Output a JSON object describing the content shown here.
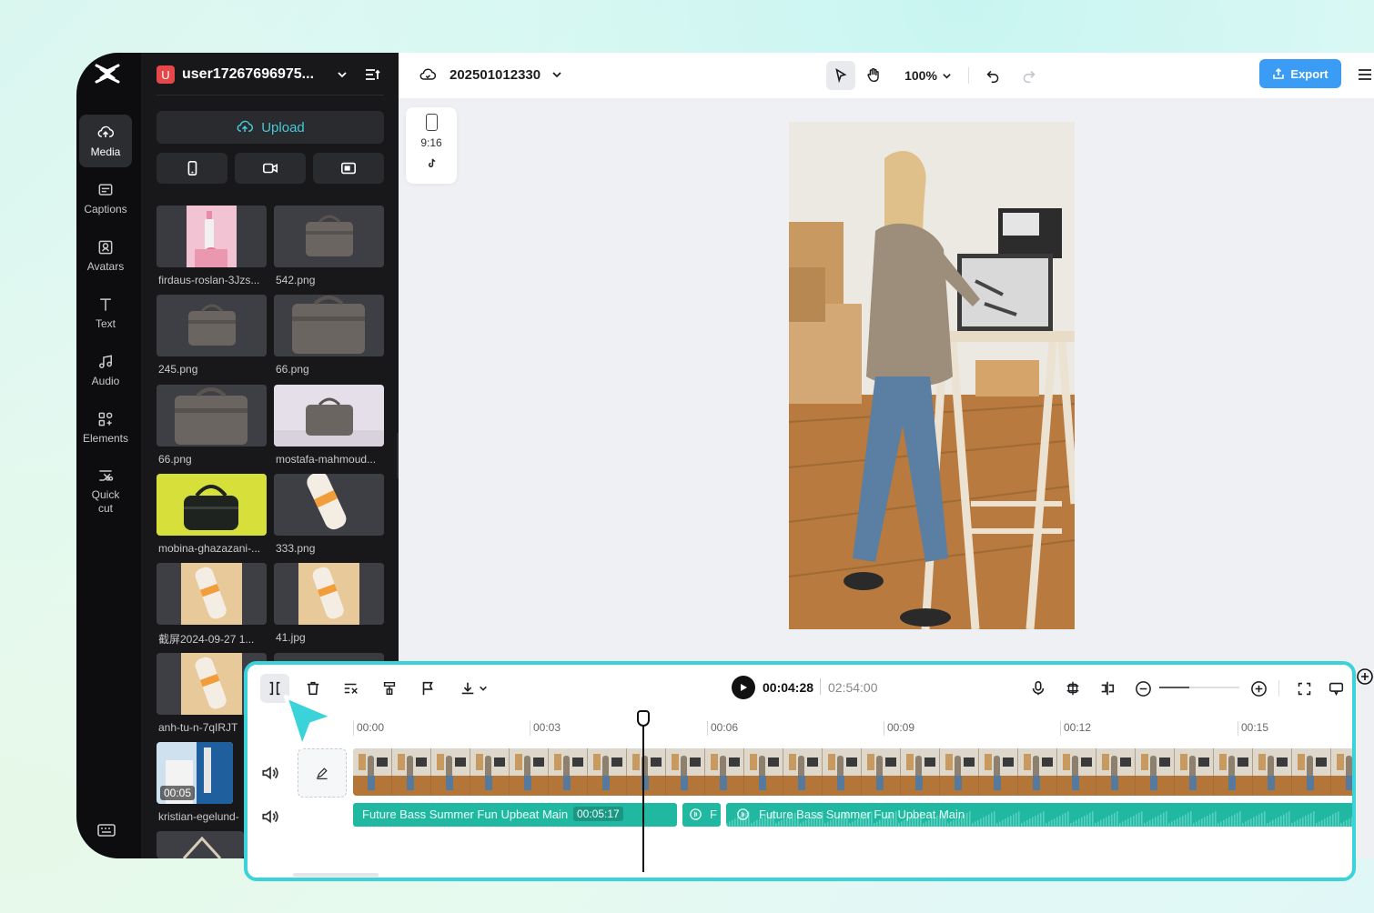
{
  "rail": {
    "items": [
      {
        "label": "Media",
        "icon": "cloud-upload-icon"
      },
      {
        "label": "Captions",
        "icon": "captions-icon"
      },
      {
        "label": "Avatars",
        "icon": "avatar-icon"
      },
      {
        "label": "Text",
        "icon": "text-icon"
      },
      {
        "label": "Audio",
        "icon": "music-note-icon"
      },
      {
        "label": "Elements",
        "icon": "elements-icon"
      },
      {
        "label": "Quick cut",
        "icon": "quick-cut-icon"
      }
    ]
  },
  "media": {
    "user_initial": "U",
    "user_name": "user17267696975...",
    "upload_label": "Upload",
    "items": [
      {
        "label": "firdaus-roslan-3Jzs..."
      },
      {
        "label": "542.png"
      },
      {
        "label": "245.png"
      },
      {
        "label": "66.png"
      },
      {
        "label": "66.png"
      },
      {
        "label": "mostafa-mahmoud..."
      },
      {
        "label": "mobina-ghazazani-..."
      },
      {
        "label": "333.png"
      },
      {
        "label": "截屏2024-09-27 1..."
      },
      {
        "label": "41.jpg"
      },
      {
        "label": "anh-tu-n-7qIRJT"
      },
      {
        "label": ""
      },
      {
        "label": "kristian-egelund-",
        "duration": "00:05"
      },
      {
        "label": ""
      }
    ]
  },
  "topbar": {
    "project_name": "202501012330",
    "zoom": "100%",
    "export_label": "Export"
  },
  "canvas": {
    "ratio_label": "9:16",
    "ratio_platform_icon": "tiktok-icon"
  },
  "timeline": {
    "current_time": "00:04:28",
    "total_time": "02:54:00",
    "ruler": [
      "00:00",
      "00:03",
      "00:06",
      "00:09",
      "00:12",
      "00:15"
    ],
    "audio_clip_1": {
      "title": "Future Bass Summer Fun Upbeat Main",
      "duration": "00:05:17"
    },
    "audio_clip_2": {
      "title": "F"
    },
    "audio_clip_3": {
      "title": "Future Bass Summer Fun Upbeat Main"
    },
    "zoom_level": 0.38
  },
  "colors": {
    "accent": "#3b9cf5",
    "teal": "#39d3d9",
    "audio": "#20b8a0",
    "dark_panel": "#18181b"
  }
}
